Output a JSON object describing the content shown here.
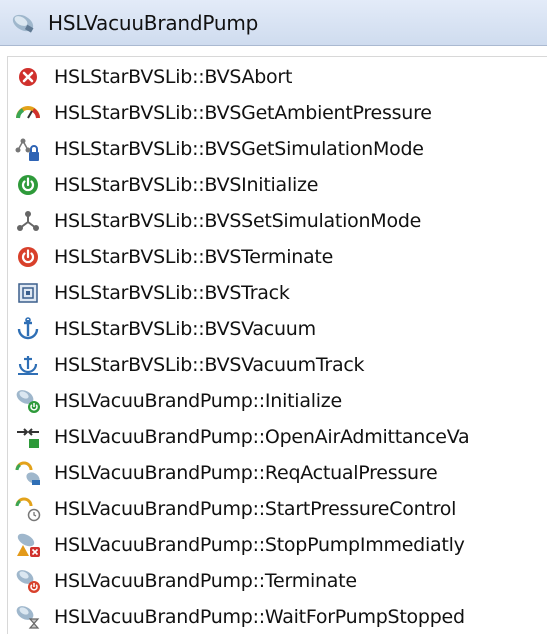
{
  "header": {
    "title": "HSLVacuuBrandPump",
    "icon": "pump-icon"
  },
  "items": [
    {
      "label": "HSLStarBVSLib::BVSAbort",
      "icon": "abort-icon"
    },
    {
      "label": "HSLStarBVSLib::BVSGetAmbientPressure",
      "icon": "pressure-gauge-icon"
    },
    {
      "label": "HSLStarBVSLib::BVSGetSimulationMode",
      "icon": "simulation-lock-icon"
    },
    {
      "label": "HSLStarBVSLib::BVSInitialize",
      "icon": "power-green-icon"
    },
    {
      "label": "HSLStarBVSLib::BVSSetSimulationMode",
      "icon": "simulation-icon"
    },
    {
      "label": "HSLStarBVSLib::BVSTerminate",
      "icon": "power-red-icon"
    },
    {
      "label": "HSLStarBVSLib::BVSTrack",
      "icon": "track-icon"
    },
    {
      "label": "HSLStarBVSLib::BVSVacuum",
      "icon": "vacuum-icon"
    },
    {
      "label": "HSLStarBVSLib::BVSVacuumTrack",
      "icon": "vacuum-track-icon"
    },
    {
      "label": "HSLVacuuBrandPump::Initialize",
      "icon": "pump-initialize-icon"
    },
    {
      "label": "HSLVacuuBrandPump::OpenAirAdmittanceVa",
      "icon": "air-admittance-icon"
    },
    {
      "label": "HSLVacuuBrandPump::ReqActualPressure",
      "icon": "pump-pressure-icon"
    },
    {
      "label": "HSLVacuuBrandPump::StartPressureControl",
      "icon": "pump-start-control-icon"
    },
    {
      "label": "HSLVacuuBrandPump::StopPumpImmediatly",
      "icon": "pump-stop-icon"
    },
    {
      "label": "HSLVacuuBrandPump::Terminate",
      "icon": "pump-terminate-icon"
    },
    {
      "label": "HSLVacuuBrandPump::WaitForPumpStopped",
      "icon": "pump-wait-icon"
    }
  ]
}
